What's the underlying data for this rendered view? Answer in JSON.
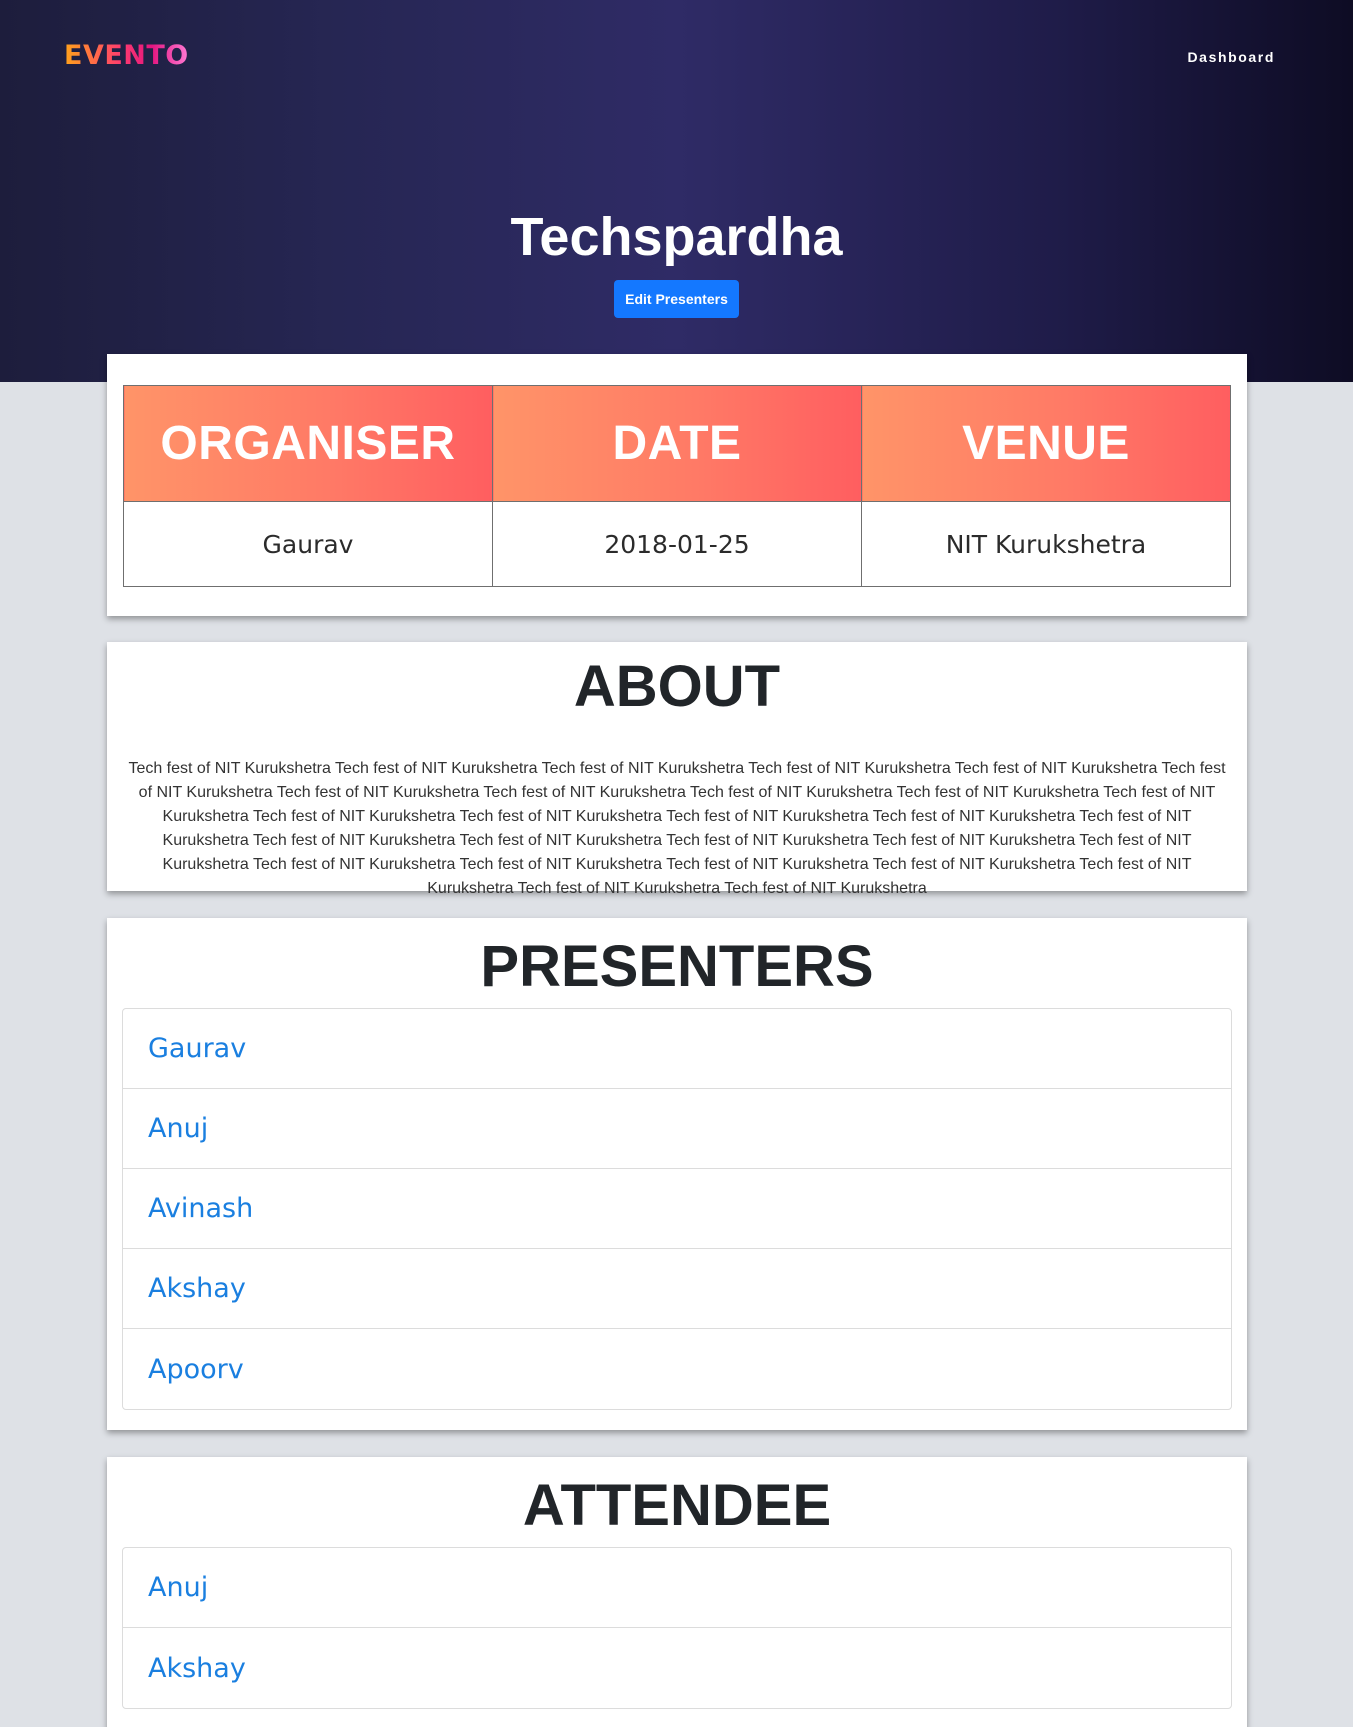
{
  "header": {
    "logo": "EVENTO",
    "nav_link": "Dashboard",
    "event_title": "Techspardha",
    "edit_button": "Edit Presenters"
  },
  "info": {
    "headers": [
      "ORGANISER",
      "DATE",
      "VENUE"
    ],
    "values": [
      "Gaurav",
      "2018-01-25",
      "NIT Kurukshetra"
    ]
  },
  "about": {
    "title": "ABOUT",
    "text": "Tech fest of NIT Kurukshetra Tech fest of NIT Kurukshetra Tech fest of NIT Kurukshetra Tech fest of NIT Kurukshetra Tech fest of NIT Kurukshetra Tech fest of NIT Kurukshetra Tech fest of NIT Kurukshetra Tech fest of NIT Kurukshetra Tech fest of NIT Kurukshetra Tech fest of NIT Kurukshetra Tech fest of NIT Kurukshetra Tech fest of NIT Kurukshetra Tech fest of NIT Kurukshetra Tech fest of NIT Kurukshetra Tech fest of NIT Kurukshetra Tech fest of NIT Kurukshetra Tech fest of NIT Kurukshetra Tech fest of NIT Kurukshetra Tech fest of NIT Kurukshetra Tech fest of NIT Kurukshetra Tech fest of NIT Kurukshetra Tech fest of NIT Kurukshetra Tech fest of NIT Kurukshetra Tech fest of NIT Kurukshetra Tech fest of NIT Kurukshetra Tech fest of NIT Kurukshetra Tech fest of NIT Kurukshetra Tech fest of NIT Kurukshetra"
  },
  "presenters": {
    "title": "PRESENTERS",
    "items": [
      "Gaurav",
      "Anuj",
      "Avinash",
      "Akshay",
      "Apoorv"
    ]
  },
  "attendee": {
    "title": "ATTENDEE",
    "items": [
      "Anuj",
      "Akshay"
    ]
  },
  "colors": {
    "hero_bg": "#2f2b66",
    "accent_button": "#1478ff",
    "header_gradient_start": "#ff9468",
    "header_gradient_end": "#ff5e60",
    "link": "#1a7fe0",
    "page_bg": "#dee1e6"
  }
}
